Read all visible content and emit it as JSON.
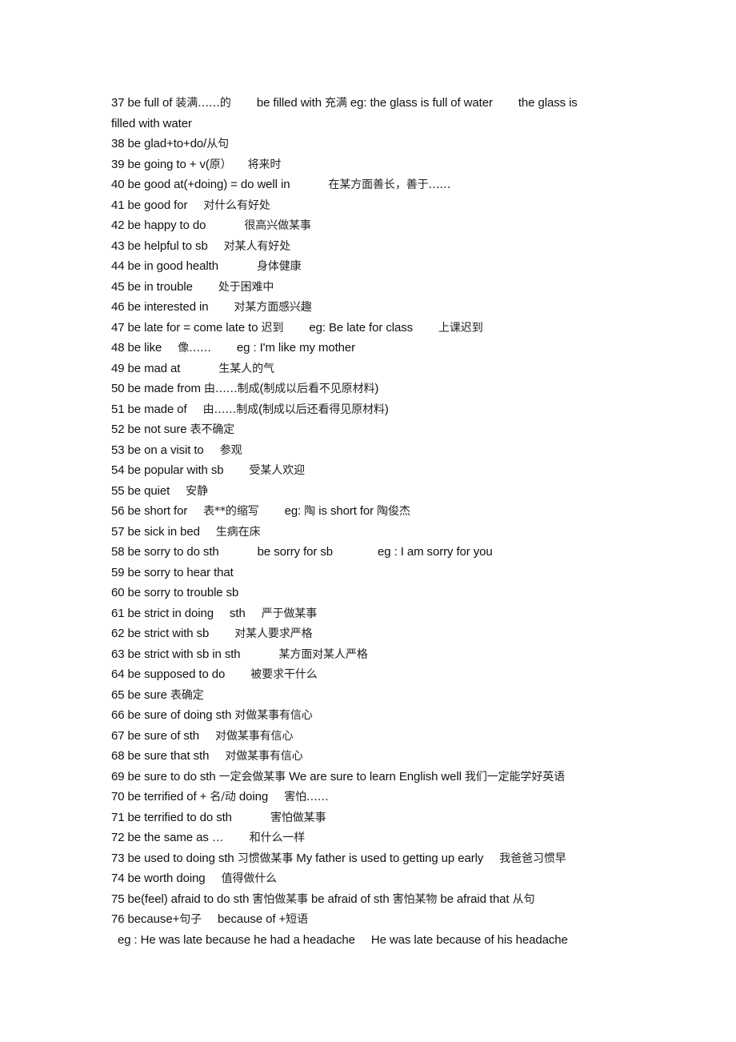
{
  "document": {
    "entries": [
      {
        "num": "37",
        "segments": [
          "37 be full of ",
          "装满……的",
          "be filled with ",
          "充满",
          " eg: the glass is full of water",
          "the glass is"
        ],
        "continuation": "filled with water"
      },
      {
        "num": "38",
        "segments": [
          "38 be glad+to+do/",
          "从句"
        ]
      },
      {
        "num": "39",
        "segments": [
          "39 be going to + v(",
          "原）",
          "将来时"
        ]
      },
      {
        "num": "40",
        "segments": [
          "40 be good at(+doing) = do well in",
          "在某方面善长，善于……"
        ]
      },
      {
        "num": "41",
        "segments": [
          "41 be good for",
          "对什么有好处"
        ]
      },
      {
        "num": "42",
        "segments": [
          "42 be happy to do",
          "很高兴做某事"
        ]
      },
      {
        "num": "43",
        "segments": [
          "43 be helpful to sb",
          "对某人有好处"
        ]
      },
      {
        "num": "44",
        "segments": [
          "44 be in good health",
          "身体健康"
        ]
      },
      {
        "num": "45",
        "segments": [
          "45 be in trouble",
          "处于困难中"
        ]
      },
      {
        "num": "46",
        "segments": [
          "46 be interested in",
          "对某方面感兴趣"
        ]
      },
      {
        "num": "47",
        "segments": [
          "47 be late for = come late to ",
          "迟到",
          "eg: Be late for class",
          "上课迟到"
        ]
      },
      {
        "num": "48",
        "segments": [
          "48 be like",
          "像……",
          "eg : I'm like my mother"
        ]
      },
      {
        "num": "49",
        "segments": [
          "49 be mad at",
          "生某人的气"
        ]
      },
      {
        "num": "50",
        "segments": [
          "50 be made from ",
          "由……制成",
          "(",
          "制成以后看不见原材料",
          ")"
        ]
      },
      {
        "num": "51",
        "segments": [
          "51 be made of",
          "由……制成",
          "(",
          "制成以后还看得见原材料",
          ")"
        ]
      },
      {
        "num": "52",
        "segments": [
          "52 be not sure ",
          "表不确定"
        ]
      },
      {
        "num": "53",
        "segments": [
          "53 be on a visit to",
          "参观"
        ]
      },
      {
        "num": "54",
        "segments": [
          "54 be popular with sb",
          "受某人欢迎"
        ]
      },
      {
        "num": "55",
        "segments": [
          "55 be quiet",
          "安静"
        ]
      },
      {
        "num": "56",
        "segments": [
          "56 be short for",
          "表**的缩写",
          "eg: ",
          "陶",
          " is short for ",
          "陶俊杰"
        ]
      },
      {
        "num": "57",
        "segments": [
          "57 be sick in bed",
          "生病在床"
        ]
      },
      {
        "num": "58",
        "segments": [
          "58 be sorry to do sth",
          "be sorry for sb",
          "eg : I am sorry for you"
        ]
      },
      {
        "num": "59",
        "segments": [
          "59 be sorry to hear that"
        ]
      },
      {
        "num": "60",
        "segments": [
          "60 be sorry to trouble sb"
        ]
      },
      {
        "num": "61",
        "segments": [
          "61 be strict in doing",
          "sth",
          "严于做某事"
        ]
      },
      {
        "num": "62",
        "segments": [
          "62 be strict with sb",
          "对某人要求严格"
        ]
      },
      {
        "num": "63",
        "segments": [
          "63 be strict with sb in sth",
          "某方面对某人严格"
        ]
      },
      {
        "num": "64",
        "segments": [
          "64 be supposed to do",
          "被要求干什么"
        ]
      },
      {
        "num": "65",
        "segments": [
          "65 be sure ",
          "表确定"
        ]
      },
      {
        "num": "66",
        "segments": [
          "66 be sure of doing sth ",
          "对做某事有信心"
        ]
      },
      {
        "num": "67",
        "segments": [
          "67 be sure of sth",
          "对做某事有信心"
        ]
      },
      {
        "num": "68",
        "segments": [
          "68 be sure that sth",
          "对做某事有信心"
        ]
      },
      {
        "num": "69",
        "segments": [
          "69 be sure to do sth ",
          "一定会做某事",
          " We are sure to learn English well ",
          "我们一定能学好英语"
        ]
      },
      {
        "num": "70",
        "segments": [
          "70 be terrified of + ",
          "名/动",
          " doing",
          "害怕……"
        ]
      },
      {
        "num": "71",
        "segments": [
          "71 be terrified to do sth",
          "害怕做某事"
        ]
      },
      {
        "num": "72",
        "segments": [
          "72 be the same as …",
          "和什么一样"
        ]
      },
      {
        "num": "73",
        "segments": [
          "73 be used to doing sth ",
          "习惯做某事",
          " My father is used to getting up early",
          "我爸爸习惯早"
        ]
      },
      {
        "num": "74",
        "segments": [
          "74 be worth doing",
          "值得做什么"
        ]
      },
      {
        "num": "75",
        "segments": [
          "75 be(feel) afraid to do sth ",
          "害怕做某事",
          " be afraid of sth ",
          "害怕某物",
          " be afraid that ",
          "从句"
        ]
      },
      {
        "num": "76",
        "segments": [
          "76 because+",
          "句子",
          "because of +",
          "短语"
        ]
      }
    ],
    "final_example": {
      "segments": [
        "eg : He was late because he had a headache",
        "He was late because of his headache"
      ]
    }
  }
}
